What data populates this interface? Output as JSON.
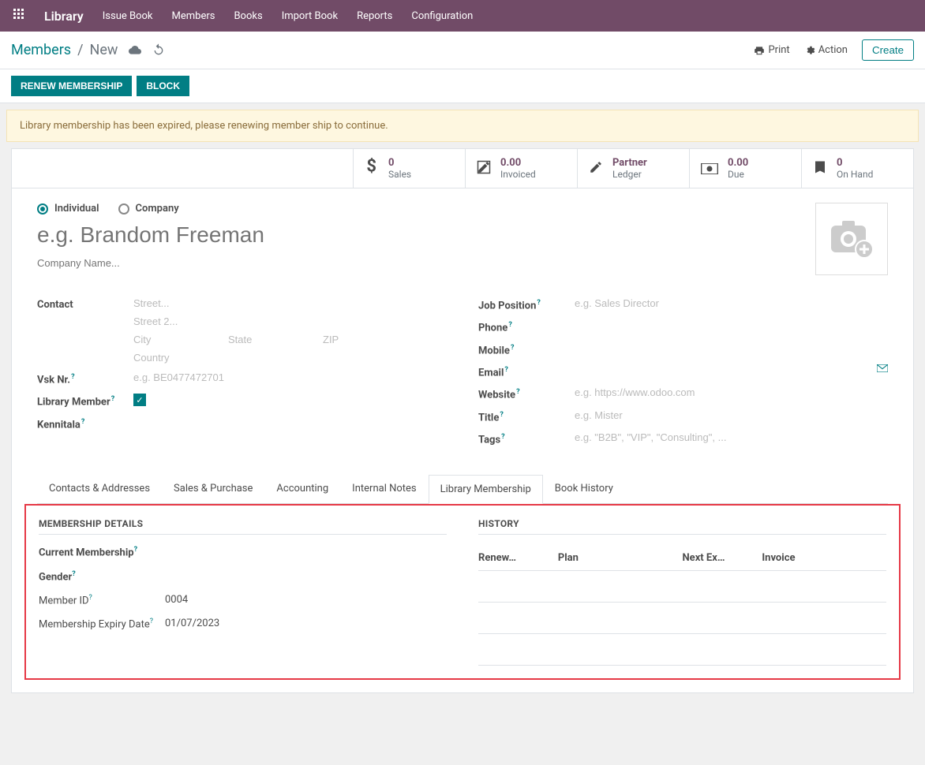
{
  "nav": {
    "brand": "Library",
    "items": [
      "Issue Book",
      "Members",
      "Books",
      "Import Book",
      "Reports",
      "Configuration"
    ]
  },
  "breadcrumb": {
    "root": "Members",
    "current": "New"
  },
  "toolbar": {
    "print": "Print",
    "action": "Action",
    "create": "Create"
  },
  "status_buttons": {
    "renew": "RENEW MEMBERSHIP",
    "block": "BLOCK"
  },
  "alert": "Library membership has been expired, please renewing member ship to continue.",
  "stats": {
    "sales": {
      "value": "0",
      "label": "Sales"
    },
    "invoiced": {
      "value": "0.00",
      "label": "Invoiced"
    },
    "ledger": {
      "value": "Partner",
      "label": "Ledger"
    },
    "due": {
      "value": "0.00",
      "label": "Due"
    },
    "onhand": {
      "value": "0",
      "label": "On Hand"
    }
  },
  "type": {
    "individual": "Individual",
    "company": "Company"
  },
  "name_placeholder": "e.g. Brandom Freeman",
  "company_placeholder": "Company Name...",
  "left_fields": {
    "contact": "Contact",
    "street_ph": "Street...",
    "street2_ph": "Street 2...",
    "city_ph": "City",
    "state_ph": "State",
    "zip_ph": "ZIP",
    "country_ph": "Country",
    "vsk": "Vsk Nr.",
    "vsk_ph": "e.g. BE0477472701",
    "library_member": "Library Member",
    "kennitala": "Kennitala"
  },
  "right_fields": {
    "job": "Job Position",
    "job_ph": "e.g. Sales Director",
    "phone": "Phone",
    "mobile": "Mobile",
    "email": "Email",
    "website": "Website",
    "website_ph": "e.g. https://www.odoo.com",
    "title": "Title",
    "title_ph": "e.g. Mister",
    "tags": "Tags",
    "tags_ph": "e.g. \"B2B\", \"VIP\", \"Consulting\", ..."
  },
  "tabs": [
    "Contacts & Addresses",
    "Sales & Purchase",
    "Accounting",
    "Internal Notes",
    "Library Membership",
    "Book History"
  ],
  "membership": {
    "details_header": "MEMBERSHIP DETAILS",
    "history_header": "HISTORY",
    "current": "Current Membership",
    "gender": "Gender",
    "member_id_label": "Member ID",
    "member_id": "0004",
    "expiry_label": "Membership Expiry Date",
    "expiry": "01/07/2023",
    "history_cols": {
      "renew": "Renew…",
      "plan": "Plan",
      "next": "Next Ex…",
      "invoice": "Invoice"
    }
  }
}
